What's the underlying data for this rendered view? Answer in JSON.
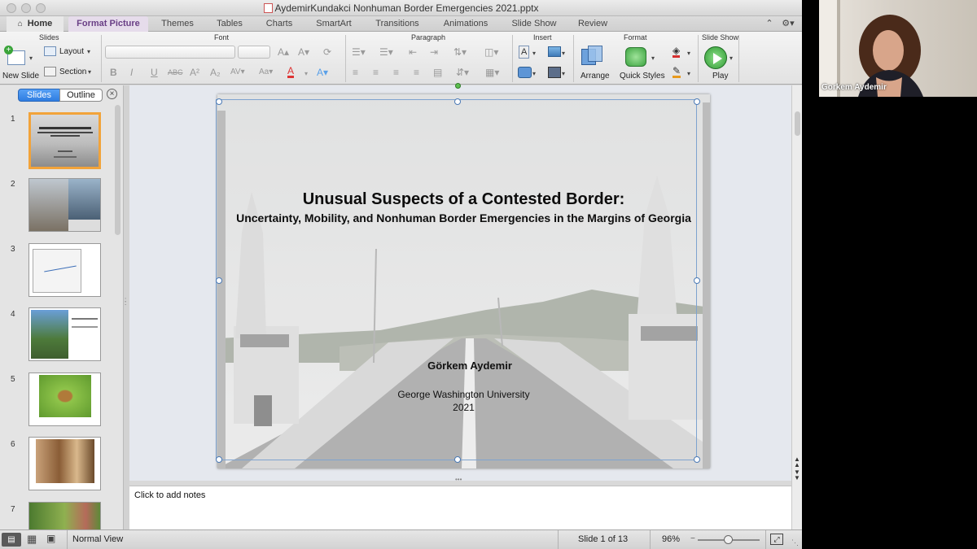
{
  "window": {
    "title": "AydemirKundakci Nonhuman Border Emergencies 2021.pptx"
  },
  "tabs": [
    "Home",
    "Format Picture",
    "Themes",
    "Tables",
    "Charts",
    "SmartArt",
    "Transitions",
    "Animations",
    "Slide Show",
    "Review"
  ],
  "ribbon": {
    "groups": {
      "slides": "Slides",
      "font": "Font",
      "paragraph": "Paragraph",
      "insert": "Insert",
      "format": "Format",
      "slideshow": "Slide Show"
    },
    "new_slide": "New Slide",
    "layout": "Layout",
    "section": "Section",
    "arrange": "Arrange",
    "quick_styles": "Quick Styles",
    "play": "Play"
  },
  "pane": {
    "tab_slides": "Slides",
    "tab_outline": "Outline",
    "slide_numbers": [
      "1",
      "2",
      "3",
      "4",
      "5",
      "6",
      "7"
    ]
  },
  "slide": {
    "title": "Unusual Suspects of a Contested Border:",
    "subtitle": "Uncertainty, Mobility, and Nonhuman Border Emergencies in the Margins of Georgia",
    "author": "Görkem Aydemir",
    "affiliation": "George Washington University",
    "year": "2021"
  },
  "notes": {
    "placeholder": "Click to add notes"
  },
  "status": {
    "view": "Normal View",
    "slide_counter": "Slide 1 of 13",
    "zoom": "96%",
    "zoom_fraction": 0.5
  },
  "webcam": {
    "name": "Gorkem Aydemir"
  },
  "colors": {
    "accent_tab": "#6a3f86",
    "selection": "#f2a33a",
    "active_seg": "#2f7de1"
  }
}
